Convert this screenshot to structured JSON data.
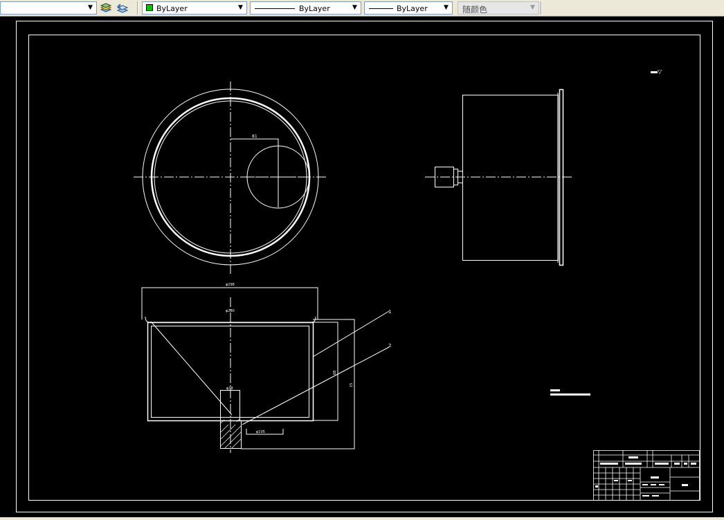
{
  "toolbar": {
    "layer_combo_value": "",
    "color_combo_value": "ByLayer",
    "linetype_combo_value": "ByLayer",
    "lineweight_combo_value": "ByLayer",
    "plotstyle_combo_value": "随颜色"
  },
  "drawing": {
    "dim_diameter_overall": "φ298",
    "dim_diameter_inner": "φ280",
    "dim_diameter_boss": "φ38",
    "dim_diameter_outlet": "φ105",
    "dim_offset": "81",
    "dim_height_inner": "68",
    "dim_height_total": "15",
    "balloon_1": "1",
    "balloon_2": "2",
    "surface_symbol": "▽"
  },
  "colors": {
    "background": "#000000",
    "lines": "#ffffff",
    "accent_green": "#00c800"
  }
}
